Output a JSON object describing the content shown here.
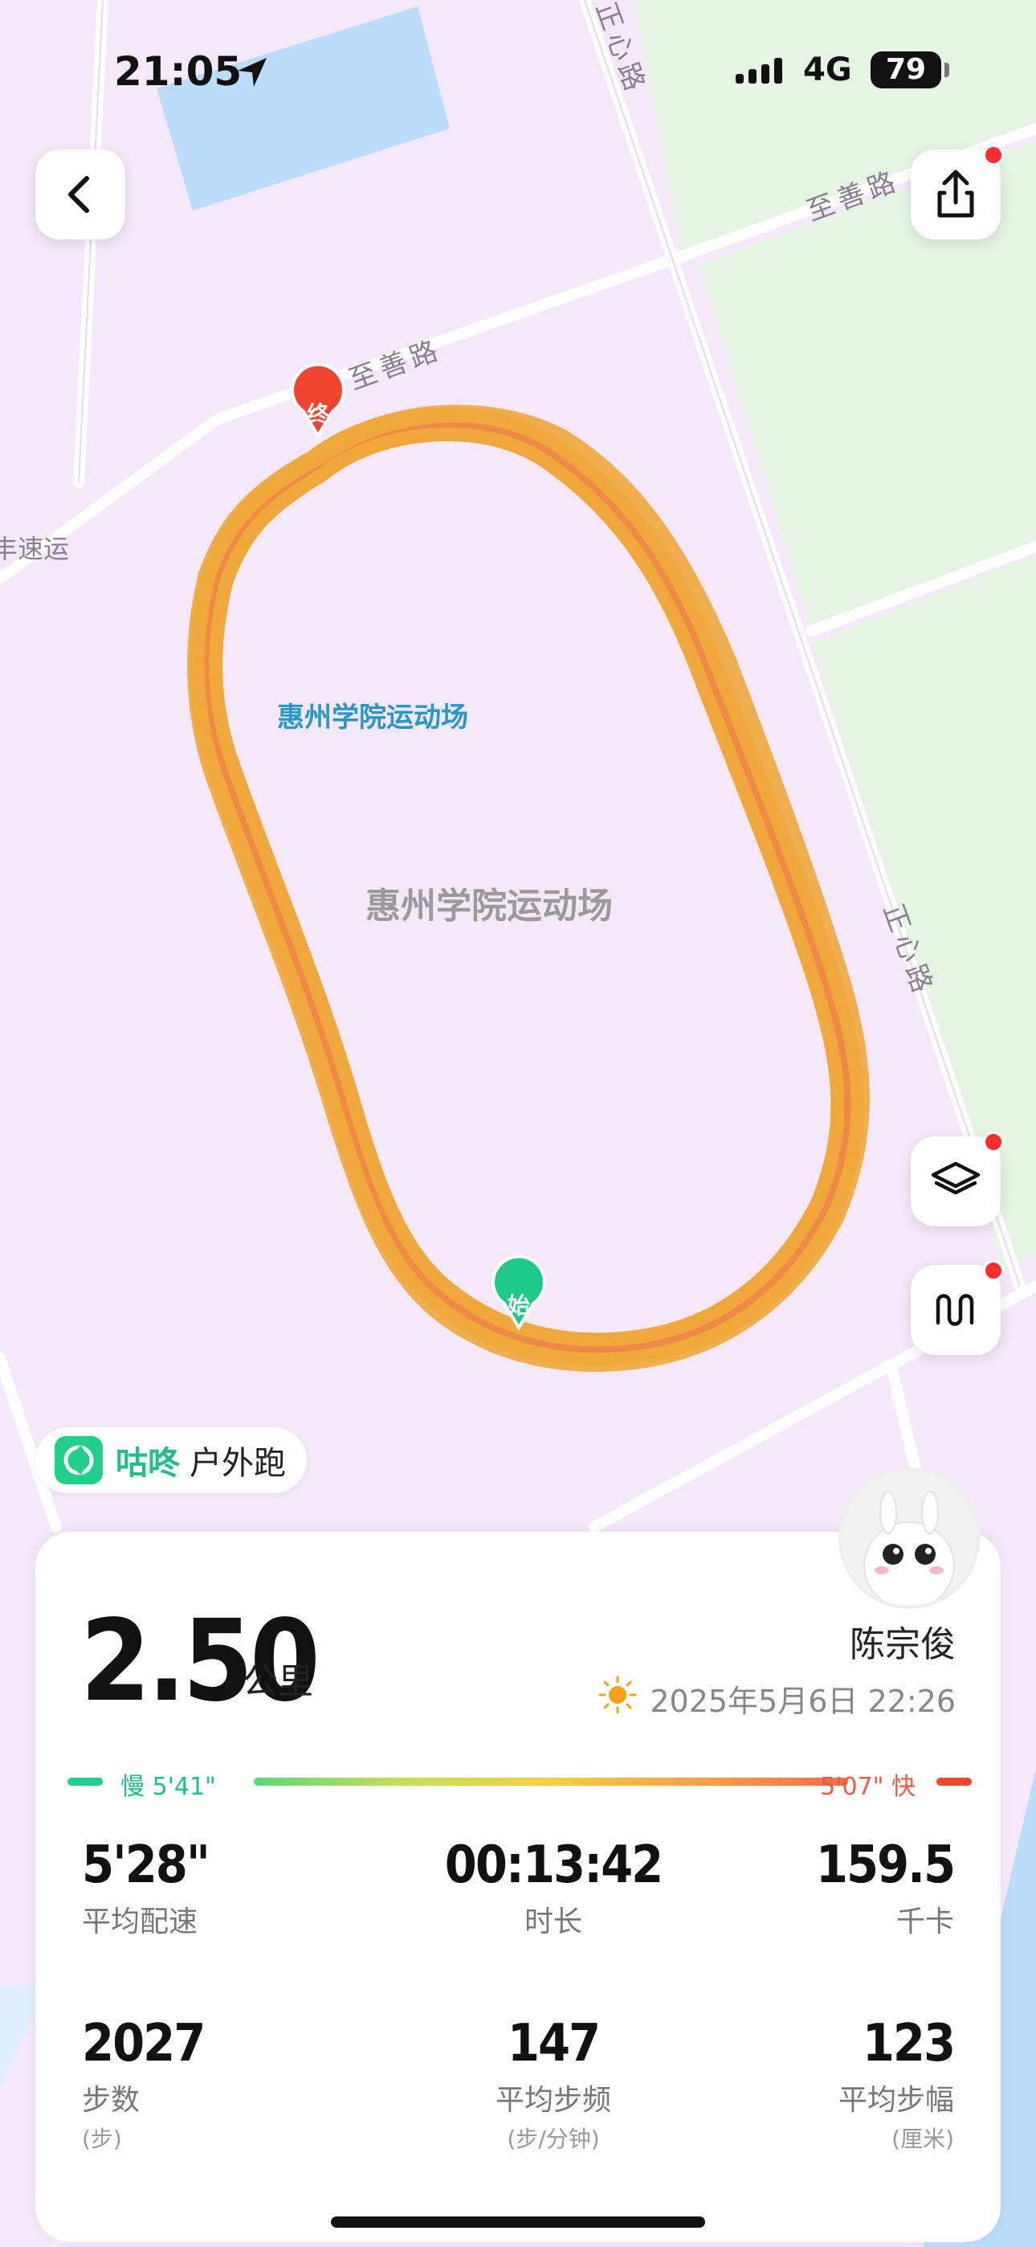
{
  "status_bar": {
    "time": "21:05",
    "network": "4G",
    "battery": "79"
  },
  "map": {
    "road_labels": {
      "top_right": "至善路",
      "middle": "至善路",
      "left": "丰速运",
      "right_vertical_top": "正心路",
      "right_vertical_mid": "正心路"
    },
    "place_labels": {
      "blue": "惠州学院运动场",
      "gray": "惠州学院运动场"
    },
    "markers": {
      "start": "始",
      "end": "终"
    },
    "colors": {
      "track": "#f0a83c",
      "track_inner": "#ef7d4a",
      "start": "#1ec98a",
      "end": "#f0452f"
    }
  },
  "brand": {
    "name": "咕咚",
    "activity": "户外跑"
  },
  "summary": {
    "distance": "2.50",
    "distance_unit": "公里",
    "user_name": "陈宗俊",
    "datetime": "2025年5月6日 22:26"
  },
  "pace_legend": {
    "slow": "慢 5'41\"",
    "fast": "5'07\" 快"
  },
  "stats": {
    "avg_pace": {
      "value": "5'28\"",
      "label": "平均配速"
    },
    "duration": {
      "value": "00:13:42",
      "label": "时长"
    },
    "calories": {
      "value": "159.5",
      "label": "千卡"
    },
    "steps": {
      "value": "2027",
      "label": "步数",
      "unit": "(步)"
    },
    "cadence": {
      "value": "147",
      "label": "平均步频",
      "unit": "(步/分钟)"
    },
    "stride": {
      "value": "123",
      "label": "平均步幅",
      "unit": "(厘米)"
    }
  }
}
